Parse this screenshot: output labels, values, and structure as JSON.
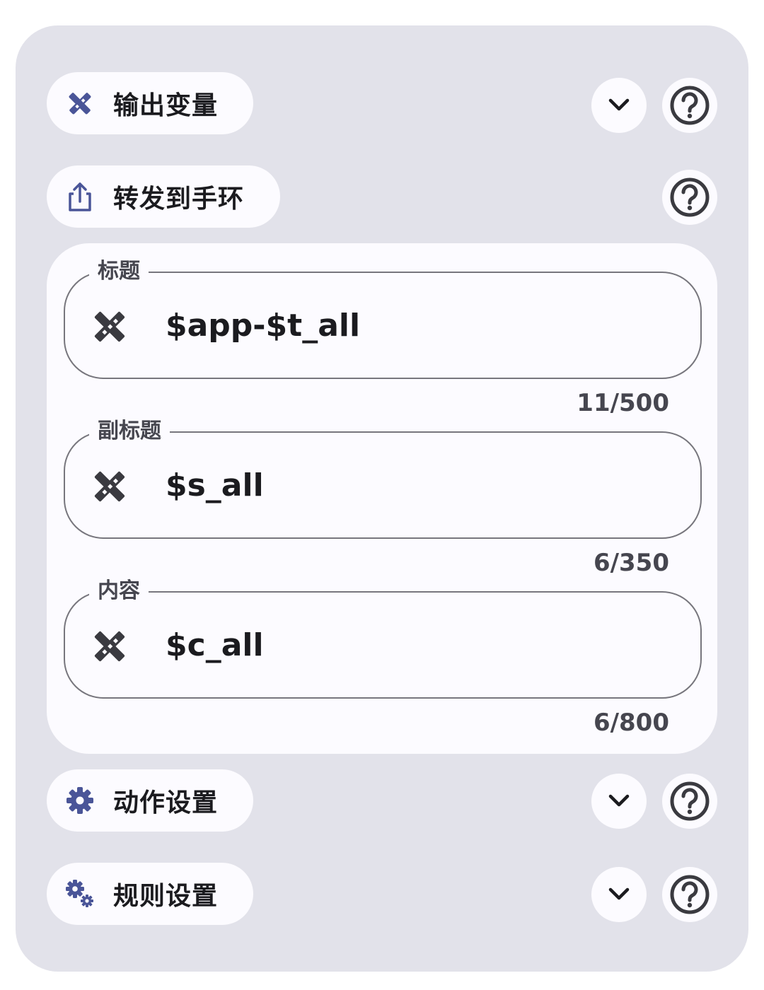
{
  "sections": {
    "output_vars": {
      "label": "输出变量",
      "icon": "variables-icon"
    },
    "forward": {
      "label": "转发到手环",
      "icon": "share-icon"
    },
    "action_settings": {
      "label": "动作设置",
      "icon": "gear-icon"
    },
    "rule_settings": {
      "label": "规则设置",
      "icon": "gears-icon"
    }
  },
  "fields": [
    {
      "label": "标题",
      "value": "$app-$t_all",
      "counter": "11/500"
    },
    {
      "label": "副标题",
      "value": "$s_all",
      "counter": "6/350"
    },
    {
      "label": "内容",
      "value": "$c_all",
      "counter": "6/800"
    }
  ],
  "colors": {
    "accent": "#4a5598",
    "panel": "#e2e2ea",
    "surface": "#fcfbff",
    "outline": "#77767d"
  }
}
